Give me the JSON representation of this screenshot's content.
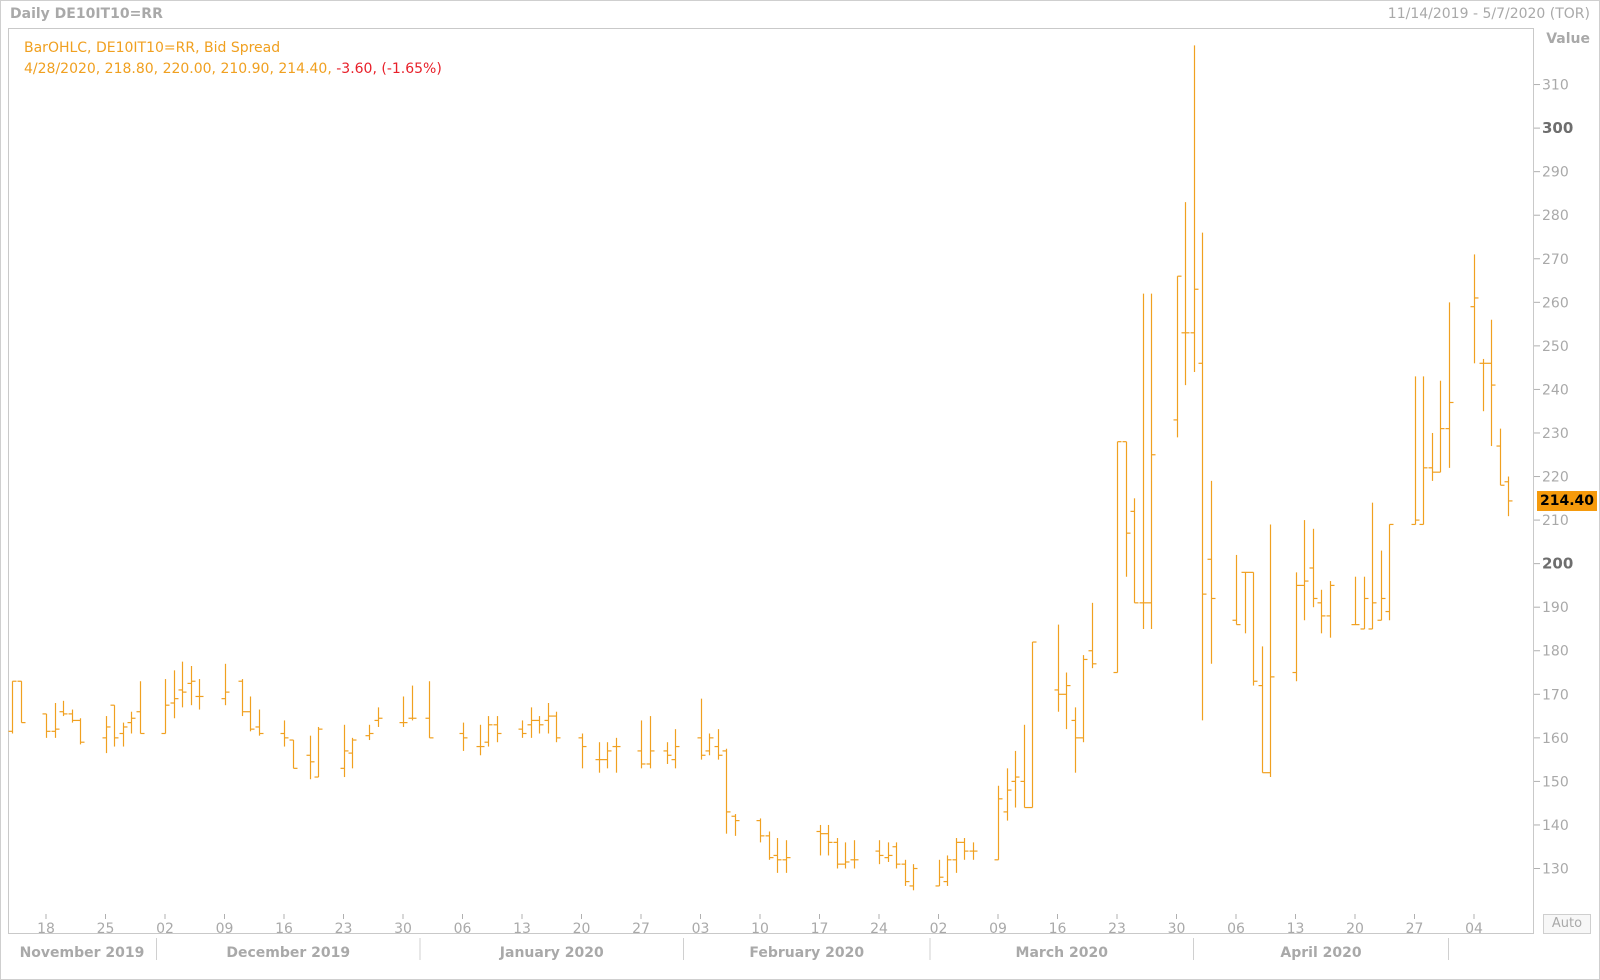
{
  "header": {
    "title": "Daily DE10IT10=RR",
    "date_range": "11/14/2019 - 5/7/2020 (TOR)"
  },
  "legend": {
    "line1": "BarOHLC, DE10IT10=RR, Bid Spread",
    "line2_prefix": "4/28/2020, 218.80, 220.00, 210.90, 214.40, ",
    "line2_change": "-3.60, (-1.65%)"
  },
  "axis": {
    "y_title": "Value",
    "last_price": "214.40",
    "auto_label": "Auto"
  },
  "colors": {
    "bar": "#f0a020",
    "negative": "#e8202a",
    "last_price_bg": "#f59a0c",
    "axis_text": "#a9a9a9"
  },
  "chart_data": {
    "type": "ohlc",
    "ylim": [
      123,
      320
    ],
    "y_ticks": [
      130,
      140,
      150,
      160,
      170,
      180,
      190,
      200,
      210,
      220,
      230,
      240,
      250,
      260,
      270,
      280,
      290,
      300,
      310
    ],
    "y_major_ticks": [
      200,
      300
    ],
    "x_ticks": [
      "18",
      "25",
      "02",
      "09",
      "16",
      "23",
      "30",
      "06",
      "13",
      "20",
      "27",
      "03",
      "10",
      "17",
      "24",
      "02",
      "09",
      "16",
      "23",
      "30",
      "06",
      "13",
      "20",
      "27",
      "04"
    ],
    "month_labels": [
      "November 2019",
      "December 2019",
      "January 2020",
      "February 2020",
      "March 2020",
      "April 2020"
    ],
    "bars": [
      {
        "date": "2019-11-14",
        "open": 161.5,
        "high": 173,
        "low": 161,
        "close": 173
      },
      {
        "date": "2019-11-15",
        "open": 173,
        "high": 173,
        "low": 163.5,
        "close": 163.5
      },
      {
        "date": "2019-11-18",
        "open": 165.5,
        "high": 165.5,
        "low": 160,
        "close": 161.5
      },
      {
        "date": "2019-11-19",
        "open": 161.5,
        "high": 168,
        "low": 160,
        "close": 162
      },
      {
        "date": "2019-11-20",
        "open": 166,
        "high": 168.5,
        "low": 165,
        "close": 165.5
      },
      {
        "date": "2019-11-21",
        "open": 165.5,
        "high": 166.5,
        "low": 163.5,
        "close": 164
      },
      {
        "date": "2019-11-22",
        "open": 164,
        "high": 164.5,
        "low": 158.5,
        "close": 159
      },
      {
        "date": "2019-11-25",
        "open": 160,
        "high": 165,
        "low": 156.5,
        "close": 162.5
      },
      {
        "date": "2019-11-26",
        "open": 167.5,
        "high": 167.5,
        "low": 158,
        "close": 160
      },
      {
        "date": "2019-11-27",
        "open": 161,
        "high": 163.5,
        "low": 158,
        "close": 162.5
      },
      {
        "date": "2019-11-28",
        "open": 163.5,
        "high": 166,
        "low": 161,
        "close": 164.5
      },
      {
        "date": "2019-11-29",
        "open": 166,
        "high": 173,
        "low": 161,
        "close": 161
      },
      {
        "date": "2019-12-02",
        "open": 161,
        "high": 173.5,
        "low": 161,
        "close": 167.5
      },
      {
        "date": "2019-12-03",
        "open": 168,
        "high": 175.5,
        "low": 164.5,
        "close": 169
      },
      {
        "date": "2019-12-04",
        "open": 171,
        "high": 177.5,
        "low": 167,
        "close": 170.5
      },
      {
        "date": "2019-12-05",
        "open": 172.5,
        "high": 176.5,
        "low": 167.5,
        "close": 173
      },
      {
        "date": "2019-12-06",
        "open": 169.5,
        "high": 173.5,
        "low": 166.5,
        "close": 169.5
      },
      {
        "date": "2019-12-09",
        "open": 169,
        "high": 177,
        "low": 167.5,
        "close": 170.5
      },
      {
        "date": "2019-12-11",
        "open": 173,
        "high": 173.5,
        "low": 165,
        "close": 166
      },
      {
        "date": "2019-12-12",
        "open": 166,
        "high": 169.5,
        "low": 161.5,
        "close": 162
      },
      {
        "date": "2019-12-13",
        "open": 162.5,
        "high": 166.5,
        "low": 160.5,
        "close": 161
      },
      {
        "date": "2019-12-16",
        "open": 161,
        "high": 164,
        "low": 158,
        "close": 160
      },
      {
        "date": "2019-12-17",
        "open": 159.5,
        "high": 159.5,
        "low": 153,
        "close": 153
      },
      {
        "date": "2019-12-19",
        "open": 156,
        "high": 160.5,
        "low": 150.5,
        "close": 154.5
      },
      {
        "date": "2019-12-20",
        "open": 151,
        "high": 162.5,
        "low": 151,
        "close": 162
      },
      {
        "date": "2019-12-23",
        "open": 153,
        "high": 163,
        "low": 151,
        "close": 157
      },
      {
        "date": "2019-12-24",
        "open": 156.5,
        "high": 160,
        "low": 153,
        "close": 159.5
      },
      {
        "date": "2019-12-26",
        "open": 160.5,
        "high": 163,
        "low": 159.5,
        "close": 161
      },
      {
        "date": "2019-12-27",
        "open": 164,
        "high": 167,
        "low": 162.5,
        "close": 164.5
      },
      {
        "date": "2019-12-30",
        "open": 163.5,
        "high": 169.5,
        "low": 162.5,
        "close": 163.5
      },
      {
        "date": "2019-12-31",
        "open": 164.5,
        "high": 172,
        "low": 164,
        "close": 164.5
      },
      {
        "date": "2020-01-02",
        "open": 164.5,
        "high": 173,
        "low": 160,
        "close": 160
      },
      {
        "date": "2020-01-06",
        "open": 161,
        "high": 163.5,
        "low": 157,
        "close": 160
      },
      {
        "date": "2020-01-08",
        "open": 158,
        "high": 163,
        "low": 156,
        "close": 158
      },
      {
        "date": "2020-01-09",
        "open": 159,
        "high": 165,
        "low": 158,
        "close": 163
      },
      {
        "date": "2020-01-10",
        "open": 163,
        "high": 165,
        "low": 159,
        "close": 161
      },
      {
        "date": "2020-01-13",
        "open": 162,
        "high": 164,
        "low": 160,
        "close": 161
      },
      {
        "date": "2020-01-14",
        "open": 163,
        "high": 167,
        "low": 160,
        "close": 164
      },
      {
        "date": "2020-01-15",
        "open": 164,
        "high": 165,
        "low": 161,
        "close": 163
      },
      {
        "date": "2020-01-16",
        "open": 164,
        "high": 168,
        "low": 161,
        "close": 165
      },
      {
        "date": "2020-01-17",
        "open": 165,
        "high": 166,
        "low": 159,
        "close": 160
      },
      {
        "date": "2020-01-20",
        "open": 160,
        "high": 161,
        "low": 153,
        "close": 158
      },
      {
        "date": "2020-01-22",
        "open": 155,
        "high": 159,
        "low": 152,
        "close": 155
      },
      {
        "date": "2020-01-23",
        "open": 155,
        "high": 159,
        "low": 153,
        "close": 157
      },
      {
        "date": "2020-01-24",
        "open": 158,
        "high": 160,
        "low": 152,
        "close": 158
      },
      {
        "date": "2020-01-27",
        "open": 157,
        "high": 164,
        "low": 153,
        "close": 154
      },
      {
        "date": "2020-01-28",
        "open": 154,
        "high": 165,
        "low": 153,
        "close": 157
      },
      {
        "date": "2020-01-30",
        "open": 157,
        "high": 159,
        "low": 154,
        "close": 156
      },
      {
        "date": "2020-01-31",
        "open": 155,
        "high": 162,
        "low": 153,
        "close": 158
      },
      {
        "date": "2020-02-03",
        "open": 160,
        "high": 169,
        "low": 155,
        "close": 156
      },
      {
        "date": "2020-02-04",
        "open": 157,
        "high": 161,
        "low": 156,
        "close": 160
      },
      {
        "date": "2020-02-05",
        "open": 158,
        "high": 162,
        "low": 155,
        "close": 156
      },
      {
        "date": "2020-02-06",
        "open": 157,
        "high": 157.5,
        "low": 138,
        "close": 143
      },
      {
        "date": "2020-02-07",
        "open": 142,
        "high": 142.5,
        "low": 137.5,
        "close": 141
      },
      {
        "date": "2020-02-10",
        "open": 141,
        "high": 141.5,
        "low": 136,
        "close": 137.5
      },
      {
        "date": "2020-02-11",
        "open": 137.5,
        "high": 138.5,
        "low": 132,
        "close": 132.5
      },
      {
        "date": "2020-02-12",
        "open": 133,
        "high": 137,
        "low": 129,
        "close": 132
      },
      {
        "date": "2020-02-13",
        "open": 132,
        "high": 136.5,
        "low": 129,
        "close": 132.5
      },
      {
        "date": "2020-02-17",
        "open": 138.5,
        "high": 140,
        "low": 133,
        "close": 138
      },
      {
        "date": "2020-02-18",
        "open": 138,
        "high": 140,
        "low": 133,
        "close": 136
      },
      {
        "date": "2020-02-19",
        "open": 136,
        "high": 137,
        "low": 130,
        "close": 131
      },
      {
        "date": "2020-02-20",
        "open": 131,
        "high": 136,
        "low": 130,
        "close": 131.5
      },
      {
        "date": "2020-02-21",
        "open": 132,
        "high": 136.5,
        "low": 130,
        "close": 132
      },
      {
        "date": "2020-02-24",
        "open": 134,
        "high": 136.5,
        "low": 131,
        "close": 133
      },
      {
        "date": "2020-02-25",
        "open": 132.5,
        "high": 136,
        "low": 131.5,
        "close": 133
      },
      {
        "date": "2020-02-26",
        "open": 135,
        "high": 136,
        "low": 130,
        "close": 131
      },
      {
        "date": "2020-02-27",
        "open": 131,
        "high": 132,
        "low": 126,
        "close": 127
      },
      {
        "date": "2020-02-28",
        "open": 126,
        "high": 131,
        "low": 125,
        "close": 130
      },
      {
        "date": "2020-03-02",
        "open": 126,
        "high": 132,
        "low": 126,
        "close": 128
      },
      {
        "date": "2020-03-03",
        "open": 127,
        "high": 133,
        "low": 126,
        "close": 132
      },
      {
        "date": "2020-03-04",
        "open": 132,
        "high": 137,
        "low": 129,
        "close": 136
      },
      {
        "date": "2020-03-05",
        "open": 136,
        "high": 137,
        "low": 132,
        "close": 134
      },
      {
        "date": "2020-03-06",
        "open": 134,
        "high": 136,
        "low": 132,
        "close": 134
      },
      {
        "date": "2020-03-09",
        "open": 132,
        "high": 149,
        "low": 132,
        "close": 146
      },
      {
        "date": "2020-03-10",
        "open": 143,
        "high": 153,
        "low": 141,
        "close": 148
      },
      {
        "date": "2020-03-11",
        "open": 150,
        "high": 157,
        "low": 144,
        "close": 151
      },
      {
        "date": "2020-03-12",
        "open": 150,
        "high": 163,
        "low": 144,
        "close": 144
      },
      {
        "date": "2020-03-13",
        "open": 144,
        "high": 182,
        "low": 144,
        "close": 182
      },
      {
        "date": "2020-03-16",
        "open": 171,
        "high": 186,
        "low": 166,
        "close": 170
      },
      {
        "date": "2020-03-17",
        "open": 170,
        "high": 175,
        "low": 162,
        "close": 172
      },
      {
        "date": "2020-03-18",
        "open": 164,
        "high": 167,
        "low": 152,
        "close": 160
      },
      {
        "date": "2020-03-19",
        "open": 160,
        "high": 179,
        "low": 159,
        "close": 178
      },
      {
        "date": "2020-03-20",
        "open": 180,
        "high": 191,
        "low": 176,
        "close": 177
      },
      {
        "date": "2020-03-23",
        "open": 175,
        "high": 228,
        "low": 175,
        "close": 228
      },
      {
        "date": "2020-03-24",
        "open": 228,
        "high": 228,
        "low": 197,
        "close": 207
      },
      {
        "date": "2020-03-25",
        "open": 212,
        "high": 215,
        "low": 191,
        "close": 191
      },
      {
        "date": "2020-03-26",
        "open": 191,
        "high": 262,
        "low": 185,
        "close": 191
      },
      {
        "date": "2020-03-27",
        "open": 191,
        "high": 262,
        "low": 185,
        "close": 225
      },
      {
        "date": "2020-03-30",
        "open": 233,
        "high": 266,
        "low": 229,
        "close": 266
      },
      {
        "date": "2020-03-31",
        "open": 253,
        "high": 283,
        "low": 241,
        "close": 253
      },
      {
        "date": "2020-04-01",
        "open": 253,
        "high": 319,
        "low": 244,
        "close": 263
      },
      {
        "date": "2020-04-02",
        "open": 246,
        "high": 276,
        "low": 164,
        "close": 193
      },
      {
        "date": "2020-04-03",
        "open": 201,
        "high": 219,
        "low": 177,
        "close": 192
      },
      {
        "date": "2020-04-06",
        "open": 187,
        "high": 202,
        "low": 186,
        "close": 186
      },
      {
        "date": "2020-04-07",
        "open": 198,
        "high": 198,
        "low": 184,
        "close": 198
      },
      {
        "date": "2020-04-08",
        "open": 198,
        "high": 198,
        "low": 172,
        "close": 173
      },
      {
        "date": "2020-04-09",
        "open": 172,
        "high": 181,
        "low": 152,
        "close": 152
      },
      {
        "date": "2020-04-10",
        "open": 152,
        "high": 209,
        "low": 151,
        "close": 174
      },
      {
        "date": "2020-04-13",
        "open": 175,
        "high": 198,
        "low": 173,
        "close": 195
      },
      {
        "date": "2020-04-14",
        "open": 195,
        "high": 210,
        "low": 187,
        "close": 196
      },
      {
        "date": "2020-04-15",
        "open": 199,
        "high": 208,
        "low": 190,
        "close": 192
      },
      {
        "date": "2020-04-16",
        "open": 191,
        "high": 194,
        "low": 184,
        "close": 188
      },
      {
        "date": "2020-04-17",
        "open": 188,
        "high": 196,
        "low": 183,
        "close": 195
      },
      {
        "date": "2020-04-20",
        "open": 186,
        "high": 197,
        "low": 186,
        "close": 186
      },
      {
        "date": "2020-04-21",
        "open": 185,
        "high": 197,
        "low": 185,
        "close": 192
      },
      {
        "date": "2020-04-22",
        "open": 185,
        "high": 214,
        "low": 185,
        "close": 191
      },
      {
        "date": "2020-04-23",
        "open": 187,
        "high": 203,
        "low": 187,
        "close": 192
      },
      {
        "date": "2020-04-24",
        "open": 189,
        "high": 209,
        "low": 187,
        "close": 209
      },
      {
        "date": "2020-04-27",
        "open": 209,
        "high": 243,
        "low": 209,
        "close": 210
      },
      {
        "date": "2020-04-28",
        "open": 209,
        "high": 243,
        "low": 209,
        "close": 222
      },
      {
        "date": "2020-04-29",
        "open": 222,
        "high": 230,
        "low": 219,
        "close": 221
      },
      {
        "date": "2020-04-30",
        "open": 221,
        "high": 242,
        "low": 221,
        "close": 231
      },
      {
        "date": "2020-05-01",
        "open": 231,
        "high": 260,
        "low": 222,
        "close": 237
      },
      {
        "date": "2020-05-04",
        "open": 259,
        "high": 271,
        "low": 246,
        "close": 261
      },
      {
        "date": "2020-05-05",
        "open": 246,
        "high": 247,
        "low": 235,
        "close": 246
      },
      {
        "date": "2020-05-06",
        "open": 246,
        "high": 256,
        "low": 227,
        "close": 241
      },
      {
        "date": "2020-05-07",
        "open": 227,
        "high": 231,
        "low": 218,
        "close": 218
      },
      {
        "date": "2020-05-08",
        "open": 218.8,
        "high": 220,
        "low": 210.9,
        "close": 214.4
      }
    ]
  }
}
